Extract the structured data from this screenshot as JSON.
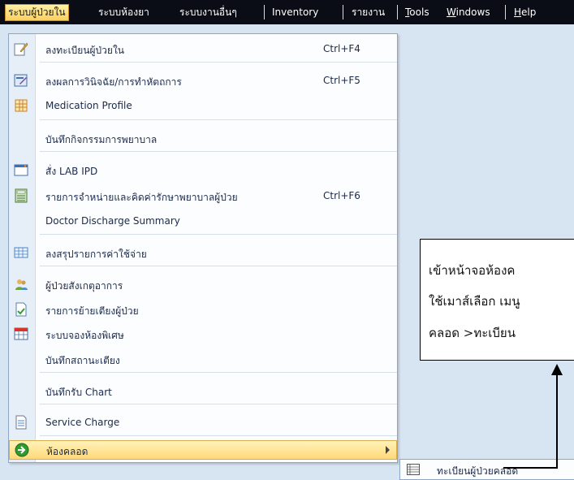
{
  "menubar": {
    "items": [
      {
        "label": "ระบบผู้ป่วยใน",
        "active": true
      },
      {
        "label": "ระบบห้องยา"
      },
      {
        "label": "ระบบงานอื่นๆ"
      },
      {
        "label": "Inventory"
      },
      {
        "label": "รายงาน"
      },
      {
        "label": "Tools",
        "mnemonic": "T"
      },
      {
        "label": "Windows",
        "mnemonic": "W"
      },
      {
        "label": "Help",
        "mnemonic": "H"
      }
    ]
  },
  "dropdown": {
    "items": [
      {
        "label": "ลงทะเบียนผู้ป่วยใน",
        "shortcut": "Ctrl+F4",
        "icon": "pencil-doc-icon"
      },
      {
        "label": "ลงผลการวินิจฉัย/การทำหัตถการ",
        "shortcut": "Ctrl+F5",
        "icon": "edit-form-icon"
      },
      {
        "label": "Medication Profile",
        "icon": "grid-calendar-icon"
      },
      {
        "label": "บันทึกกิจกรรมการพยาบาล",
        "icon": ""
      },
      {
        "label": "สั่ง LAB IPD",
        "icon": "window-icon"
      },
      {
        "label": "รายการจำหน่ายและคิดค่ารักษาพยาบาลผู้ป่วย",
        "shortcut": "Ctrl+F6",
        "icon": "calculator-icon"
      },
      {
        "label": "Doctor Discharge Summary",
        "icon": ""
      },
      {
        "label": "ลงสรุปรายการค่าใช้จ่าย",
        "icon": "table-icon"
      },
      {
        "label": "ผู้ป่วยสังเกตุอาการ",
        "icon": "users-icon"
      },
      {
        "label": "รายการย้ายเตียงผู้ป่วย",
        "icon": "document-icon"
      },
      {
        "label": "ระบบจองห้องพิเศษ",
        "icon": "calendar-icon"
      },
      {
        "label": "บันทึกสถานะเตียง",
        "icon": ""
      },
      {
        "label": "บันทึกรับ Chart",
        "icon": ""
      },
      {
        "label": "Service Charge",
        "icon": "sheet-icon"
      },
      {
        "label": "ห้องคลอด",
        "icon": "green-arrow-icon",
        "highlighted": true,
        "has_submenu": true
      }
    ]
  },
  "submenu": {
    "items": [
      {
        "label": "ทะเบียนผู้ป่วยคลอด",
        "icon": "list-icon"
      }
    ]
  },
  "callout": {
    "lines": [
      "เข้าหน้าจอห้องค",
      "ใช้เมาส์เลือก เมนู",
      "คลอด >ทะเบียน"
    ]
  }
}
